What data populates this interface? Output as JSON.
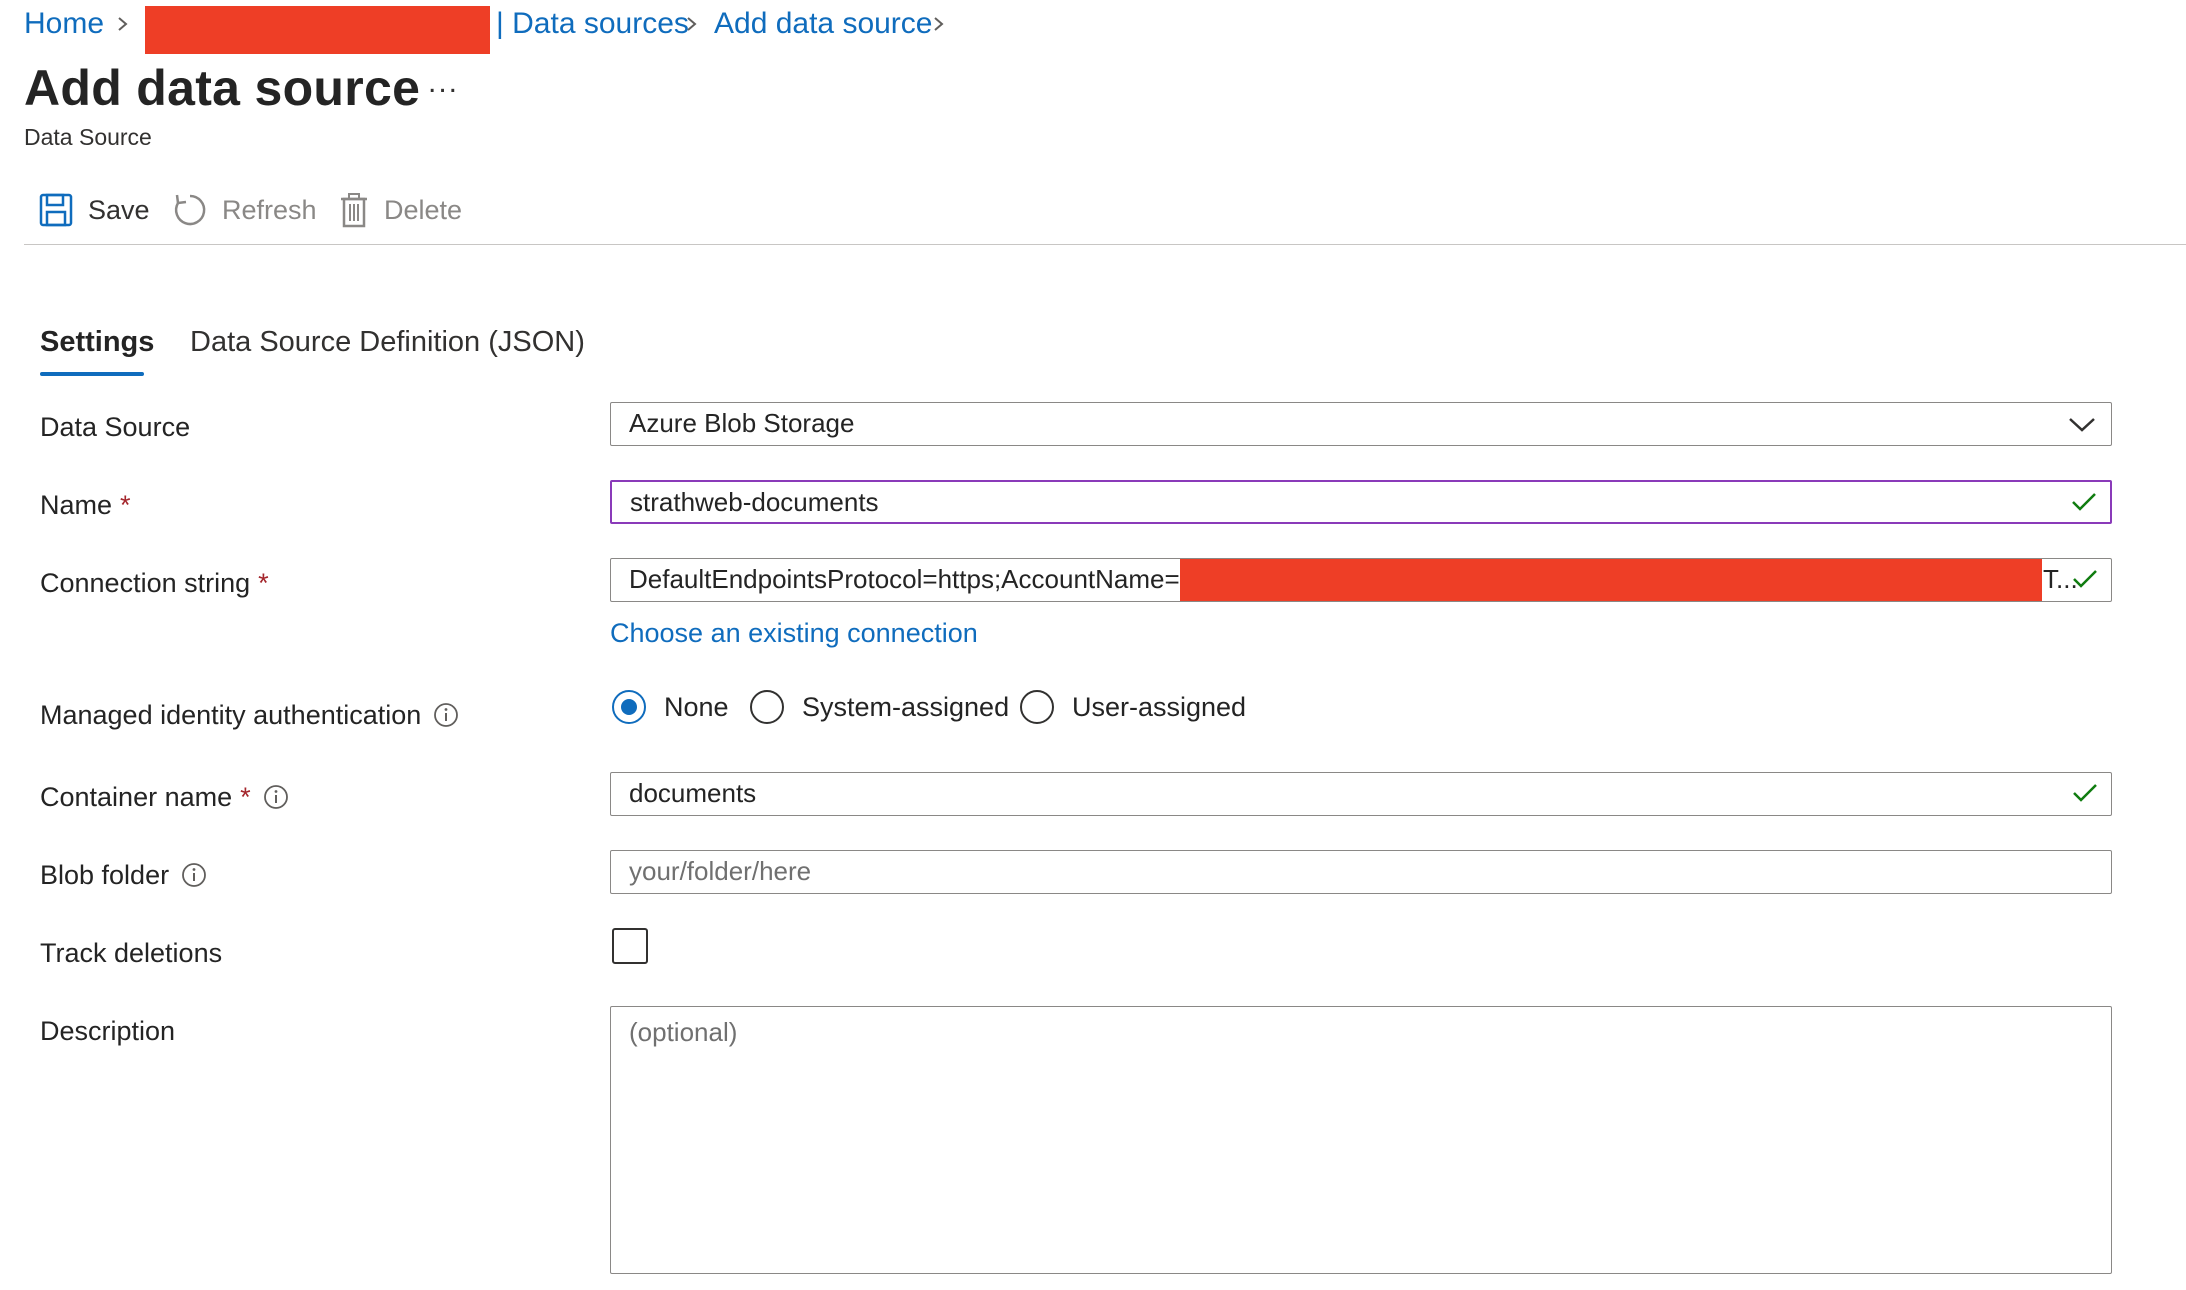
{
  "breadcrumb": {
    "home": "Home",
    "data_sources": "| Data sources",
    "add_data_source": "Add data source"
  },
  "header": {
    "title": "Add data source",
    "more": "...",
    "subtitle": "Data Source"
  },
  "toolbar": {
    "save": "Save",
    "refresh": "Refresh",
    "delete": "Delete"
  },
  "tabs": [
    {
      "label": "Settings",
      "active": true
    },
    {
      "label": "Data Source Definition (JSON)",
      "active": false
    }
  ],
  "form": {
    "data_source": {
      "label": "Data Source",
      "value": "Azure Blob Storage"
    },
    "name": {
      "label": "Name",
      "required": "*",
      "value": "strathweb-documents"
    },
    "connection_string": {
      "label": "Connection string",
      "required": "*",
      "value": "DefaultEndpointsProtocol=https;AccountName=",
      "value_tail": "T...",
      "choose_link": "Choose an existing connection"
    },
    "managed_identity": {
      "label": "Managed identity authentication",
      "options": [
        "None",
        "System-assigned",
        "User-assigned"
      ],
      "selected": "None"
    },
    "container_name": {
      "label": "Container name",
      "required": "*",
      "value": "documents"
    },
    "blob_folder": {
      "label": "Blob folder",
      "placeholder": "your/folder/here"
    },
    "track_deletions": {
      "label": "Track deletions",
      "checked": false
    },
    "description": {
      "label": "Description",
      "placeholder": "(optional)"
    }
  },
  "colors": {
    "accent": "#0f6cbd",
    "focus_border": "#8a3ab9",
    "required": "#a4262c",
    "valid_check": "#107c10",
    "redaction": "#ee3e26"
  }
}
